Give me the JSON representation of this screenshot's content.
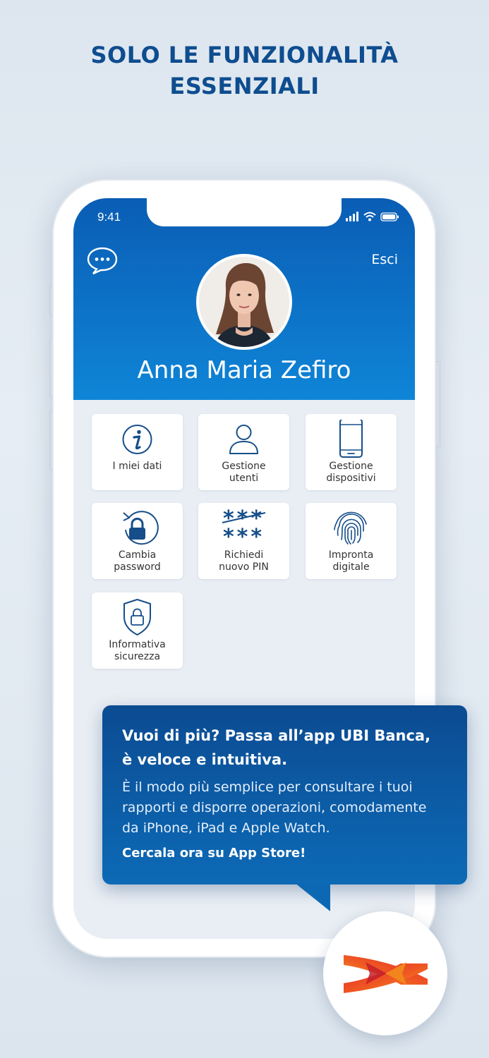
{
  "headline": {
    "line1": "SOLO LE FUNZIONALITÀ",
    "line2": "ESSENZIALI"
  },
  "status_bar": {
    "time": "9:41"
  },
  "header": {
    "logout_label": "Esci",
    "user_name": "Anna Maria Zefiro"
  },
  "menu": [
    {
      "line1": "I miei dati",
      "line2": "",
      "icon": "info-icon"
    },
    {
      "line1": "Gestione",
      "line2": "utenti",
      "icon": "user-icon"
    },
    {
      "line1": "Gestione",
      "line2": "dispositivi",
      "icon": "smartphone-icon"
    },
    {
      "line1": "Cambia",
      "line2": "password",
      "icon": "lock-refresh-icon"
    },
    {
      "line1": "Richiedi",
      "line2": "nuovo PIN",
      "icon": "pin-asterisks-icon"
    },
    {
      "line1": "Impronta",
      "line2": "digitale",
      "icon": "fingerprint-icon"
    },
    {
      "line1": "Informativa",
      "line2": "sicurezza",
      "icon": "shield-lock-icon"
    }
  ],
  "promo": {
    "title_line1": "Vuoi di più? Passa all’app UBI Banca,",
    "title_line2": "è veloce e intuitiva.",
    "body": "È il modo più semplice per consultare i tuoi rapporti e disporre operazioni, comodamente da iPhone, iPad e Apple Watch.",
    "cta": "Cercala ora su App Store!"
  },
  "colors": {
    "brand_blue": "#0e4d8f",
    "header_top": "#0a5db4",
    "header_bottom": "#0f85d7",
    "icon_blue": "#164e89",
    "logo_red": "#e52d27",
    "logo_orange": "#f39c12"
  }
}
